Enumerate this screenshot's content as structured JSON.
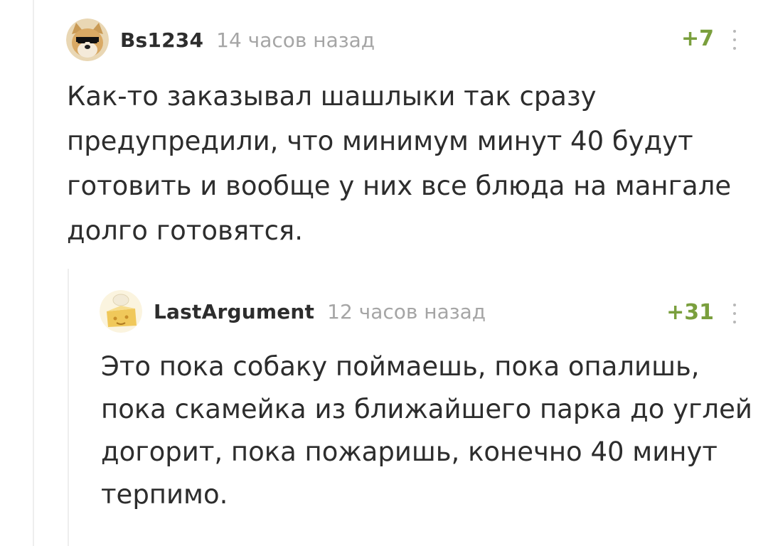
{
  "thread": {
    "comment": {
      "author": "Bs1234",
      "time": "14 часов назад",
      "rating": "+7",
      "avatar_icon": "doge-with-sunglasses-avatar",
      "text": "Как-то заказывал шашлыки так сразу предупредили, что минимум минут 40 будут готовить и вообще у них все блюда на мангале долго готовятся."
    },
    "reply": {
      "author": "LastArgument",
      "time": "12 часов назад",
      "rating": "+31",
      "avatar_icon": "chef-cheese-avatar",
      "text": "Это пока собаку поймаешь, пока опалишь, пока скамейка из ближайшего парка до углей догорит, пока пожаришь, конечно 40 минут терпимо."
    }
  },
  "colors": {
    "rating": "#7a9f3d",
    "time": "#a5a5a5",
    "text": "#2d2d2d",
    "thread_line": "#eeeeee"
  }
}
